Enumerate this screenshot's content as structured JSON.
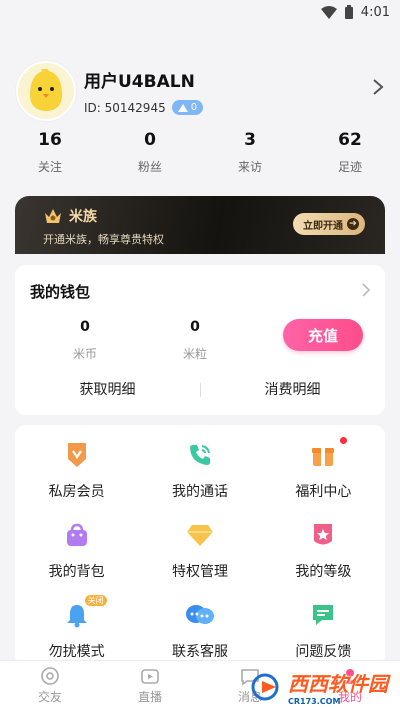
{
  "status_bar": {
    "time": "4:01"
  },
  "profile": {
    "username": "用户U4BALN",
    "id_text": "ID: 50142945",
    "level": "0"
  },
  "stats": [
    {
      "value": "16",
      "label": "关注"
    },
    {
      "value": "0",
      "label": "粉丝"
    },
    {
      "value": "3",
      "label": "来访"
    },
    {
      "value": "62",
      "label": "足迹"
    }
  ],
  "vip": {
    "title": "米族",
    "subtitle": "开通米族，畅享尊贵特权",
    "button": "立即开通"
  },
  "wallet": {
    "title": "我的钱包",
    "coins": {
      "value": "0",
      "label": "米币"
    },
    "grains": {
      "value": "0",
      "label": "米粒"
    },
    "recharge": "充值",
    "income_detail": "获取明细",
    "spend_detail": "消费明细"
  },
  "menu": {
    "items": [
      {
        "label": "私房会员",
        "icon": "vip-medal-icon"
      },
      {
        "label": "我的通话",
        "icon": "phone-call-icon"
      },
      {
        "label": "福利中心",
        "icon": "gift-icon"
      },
      {
        "label": "我的背包",
        "icon": "backpack-icon"
      },
      {
        "label": "特权管理",
        "icon": "diamond-icon"
      },
      {
        "label": "我的等级",
        "icon": "level-icon"
      },
      {
        "label": "勿扰模式",
        "icon": "bell-icon",
        "tag": "关闭"
      },
      {
        "label": "联系客服",
        "icon": "chat-bubbles-icon"
      },
      {
        "label": "问题反馈",
        "icon": "feedback-icon"
      }
    ]
  },
  "tabbar": [
    {
      "label": "交友"
    },
    {
      "label": "直播"
    },
    {
      "label": "消息"
    },
    {
      "label": "我的"
    }
  ],
  "watermark": {
    "text": "西西软件园",
    "small": "CR173.COM"
  },
  "colors": {
    "accent": "#ff4d8b",
    "gold": "#f3d9a8",
    "badge": "#7fb6f5"
  }
}
